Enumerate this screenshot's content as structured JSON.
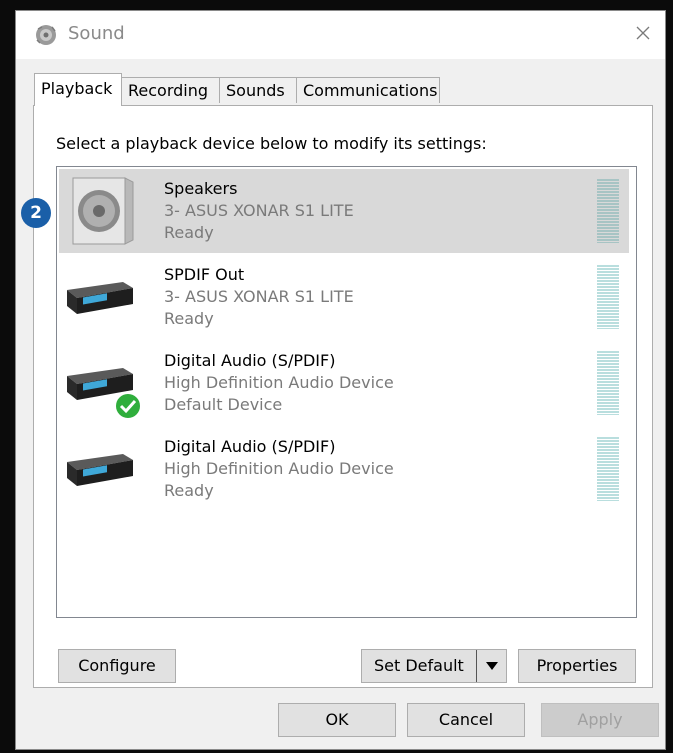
{
  "window": {
    "title": "Sound",
    "icons": {
      "title": "speaker-sound-icon",
      "close": "close-icon"
    }
  },
  "tabs": [
    {
      "label": "Playback",
      "active": true
    },
    {
      "label": "Recording",
      "active": false
    },
    {
      "label": "Sounds",
      "active": false
    },
    {
      "label": "Communications",
      "active": false
    }
  ],
  "playback": {
    "instruction": "Select a playback device below to modify its settings:",
    "devices": [
      {
        "name": "Speakers",
        "description": "3- ASUS XONAR S1 LITE",
        "status": "Ready",
        "icon": "speaker-icon",
        "selected": true
      },
      {
        "name": "SPDIF Out",
        "description": "3- ASUS XONAR S1 LITE",
        "status": "Ready",
        "icon": "digital-receiver-icon",
        "selected": false
      },
      {
        "name": "Digital Audio (S/PDIF)",
        "description": "High Definition Audio Device",
        "status": "Default Device",
        "icon": "digital-receiver-icon",
        "selected": false,
        "default": true
      },
      {
        "name": "Digital Audio (S/PDIF)",
        "description": "High Definition Audio Device",
        "status": "Ready",
        "icon": "digital-receiver-icon",
        "selected": false
      }
    ],
    "buttons": {
      "configure": "Configure",
      "set_default": "Set Default",
      "properties": "Properties"
    }
  },
  "footer": {
    "ok": "OK",
    "cancel": "Cancel",
    "apply": "Apply"
  },
  "annotation": {
    "badge": "2",
    "color": "#1a5fa8"
  }
}
